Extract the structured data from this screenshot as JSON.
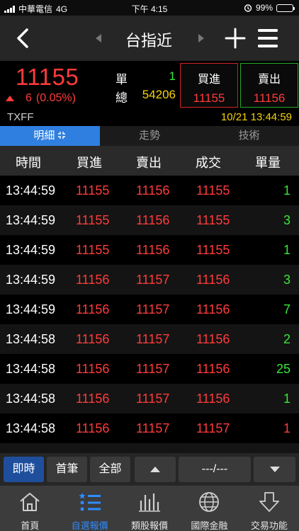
{
  "status_bar": {
    "carrier": "中華電信",
    "network": "4G",
    "time": "下午 4:15",
    "battery": "99%"
  },
  "nav": {
    "title": "台指近"
  },
  "quote": {
    "price": "11155",
    "change": "6",
    "change_pct": "(0.05%)",
    "label_single": "單",
    "label_total": "總",
    "single_volume": "1",
    "total_volume": "54206",
    "buy_label": "買進",
    "buy_price": "11155",
    "sell_label": "賣出",
    "sell_price": "11156",
    "symbol": "TXFF",
    "datetime": "10/21 13:44:59"
  },
  "tabs": [
    {
      "label": "明細"
    },
    {
      "label": "走勢"
    },
    {
      "label": "技術"
    }
  ],
  "table": {
    "headers": [
      "時間",
      "買進",
      "賣出",
      "成交",
      "單量"
    ],
    "rows": [
      [
        "13:44:59",
        "11155",
        "11156",
        "11155",
        "1"
      ],
      [
        "13:44:59",
        "11155",
        "11156",
        "11155",
        "3"
      ],
      [
        "13:44:59",
        "11155",
        "11156",
        "11155",
        "1"
      ],
      [
        "13:44:59",
        "11156",
        "11157",
        "11156",
        "3"
      ],
      [
        "13:44:59",
        "11156",
        "11157",
        "11156",
        "7"
      ],
      [
        "13:44:58",
        "11156",
        "11157",
        "11156",
        "2"
      ],
      [
        "13:44:58",
        "11156",
        "11157",
        "11156",
        "25"
      ],
      [
        "13:44:58",
        "11156",
        "11157",
        "11156",
        "1"
      ],
      [
        "13:44:58",
        "11156",
        "11157",
        "11157",
        "1"
      ]
    ],
    "volume_colors": [
      "green",
      "green",
      "green",
      "green",
      "green",
      "green",
      "green",
      "green",
      "red"
    ]
  },
  "controls": {
    "realtime_label": "即時",
    "first_label": "首筆",
    "all_label": "全部",
    "page_indicator": "---/---"
  },
  "tabbar": [
    {
      "label": "首頁",
      "icon": "home-icon"
    },
    {
      "label": "自選報價",
      "icon": "watchlist-icon"
    },
    {
      "label": "類股報價",
      "icon": "bar-chart-icon"
    },
    {
      "label": "國際金融",
      "icon": "globe-icon"
    },
    {
      "label": "交易功能",
      "icon": "trade-arrow-icon"
    }
  ],
  "colors": {
    "up": "#ff3b3b",
    "down": "#39e539",
    "accent": "#2f7fe0",
    "volume_total": "#f5d20c"
  }
}
